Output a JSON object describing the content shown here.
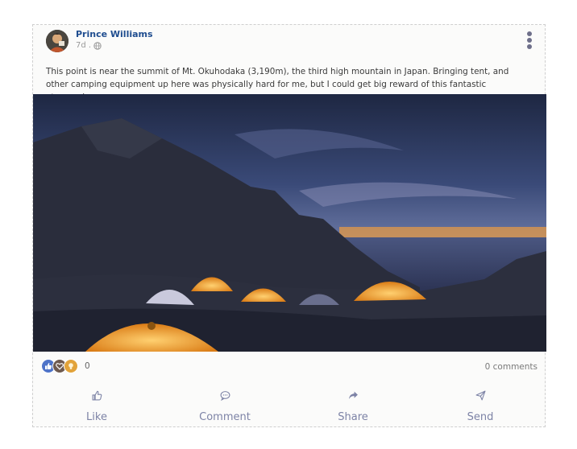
{
  "post": {
    "author": "Prince Williams",
    "time": "7d .",
    "text": "This point is near the summit of Mt. Okuhodaka (3,190m), the third high mountain in Japan. Bringing tent, and other camping equipment up here was physically hard for me, but I could get big reward of this fantastic atomosphere.",
    "image_alt": "Tents glowing at dusk near a mountain summit above a sea of clouds"
  },
  "reactions": {
    "icons": [
      "like-icon",
      "heart-icon",
      "lightbulb-icon"
    ],
    "count": "0"
  },
  "comments": {
    "label": "0 comments"
  },
  "actions": {
    "like": "Like",
    "comment": "Comment",
    "share": "Share",
    "send": "Send"
  },
  "colors": {
    "author_link": "#1f4d8f",
    "action_text": "#7d83a6",
    "like": "#4e73c8",
    "love": "#6e5a4f",
    "idea": "#e2a33a"
  }
}
